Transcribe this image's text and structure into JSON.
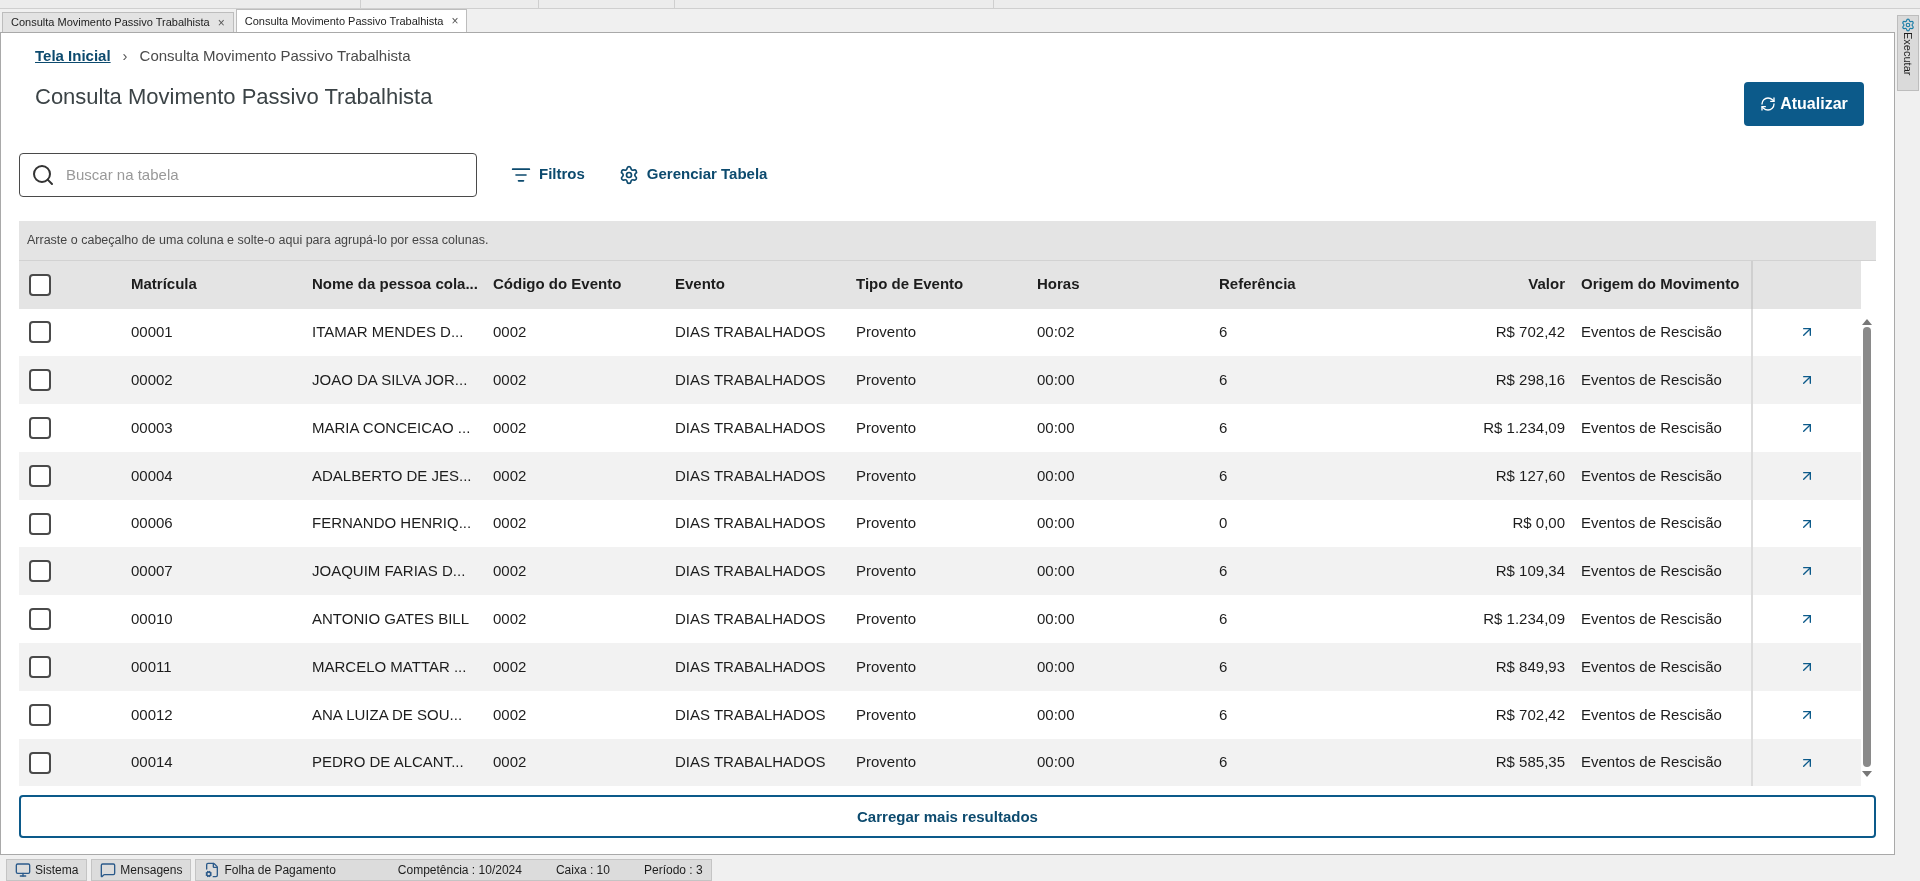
{
  "tabs": [
    {
      "label": "Consulta Movimento Passivo Trabalhista",
      "close": "×",
      "selected": false
    },
    {
      "label": "Consulta Movimento Passivo Trabalhista",
      "close": "×",
      "selected": true
    }
  ],
  "side_panel": {
    "label": "Executar"
  },
  "breadcrumb": {
    "link": "Tela Inicial",
    "separator": "›",
    "current": "Consulta Movimento Passivo Trabalhista"
  },
  "page_title": "Consulta Movimento Passivo Trabalhista",
  "refresh_button": "Atualizar",
  "search": {
    "placeholder": "Buscar na tabela"
  },
  "filters_button": "Filtros",
  "manage_table_button": "Gerenciar Tabela",
  "group_hint": "Arraste o cabeçalho de uma coluna e solte-o aqui para agrupá-lo por essa colunas.",
  "table": {
    "select_all_checked": false,
    "columns": [
      "Matrícula",
      "Nome da pessoa cola...",
      "Código do Evento",
      "Evento",
      "Tipo de Evento",
      "Horas",
      "Referência",
      "Valor",
      "Origem do Movimento"
    ],
    "rows": [
      {
        "checked": false,
        "cells": [
          "00001",
          "ITAMAR MENDES D...",
          "0002",
          "DIAS TRABALHADOS",
          "Provento",
          "00:02",
          "6",
          "R$ 702,42",
          "Eventos de Rescisão"
        ]
      },
      {
        "checked": false,
        "cells": [
          "00002",
          "JOAO DA SILVA JOR...",
          "0002",
          "DIAS TRABALHADOS",
          "Provento",
          "00:00",
          "6",
          "R$ 298,16",
          "Eventos de Rescisão"
        ]
      },
      {
        "checked": false,
        "cells": [
          "00003",
          "MARIA CONCEICAO ...",
          "0002",
          "DIAS TRABALHADOS",
          "Provento",
          "00:00",
          "6",
          "R$ 1.234,09",
          "Eventos de Rescisão"
        ]
      },
      {
        "checked": false,
        "cells": [
          "00004",
          "ADALBERTO DE JES...",
          "0002",
          "DIAS TRABALHADOS",
          "Provento",
          "00:00",
          "6",
          "R$ 127,60",
          "Eventos de Rescisão"
        ]
      },
      {
        "checked": false,
        "cells": [
          "00006",
          "FERNANDO HENRIQ...",
          "0002",
          "DIAS TRABALHADOS",
          "Provento",
          "00:00",
          "0",
          "R$ 0,00",
          "Eventos de Rescisão"
        ]
      },
      {
        "checked": false,
        "cells": [
          "00007",
          "JOAQUIM FARIAS D...",
          "0002",
          "DIAS TRABALHADOS",
          "Provento",
          "00:00",
          "6",
          "R$ 109,34",
          "Eventos de Rescisão"
        ]
      },
      {
        "checked": false,
        "cells": [
          "00010",
          "ANTONIO GATES BILL",
          "0002",
          "DIAS TRABALHADOS",
          "Provento",
          "00:00",
          "6",
          "R$ 1.234,09",
          "Eventos de Rescisão"
        ]
      },
      {
        "checked": false,
        "cells": [
          "00011",
          "MARCELO MATTAR ...",
          "0002",
          "DIAS TRABALHADOS",
          "Provento",
          "00:00",
          "6",
          "R$ 849,93",
          "Eventos de Rescisão"
        ]
      },
      {
        "checked": false,
        "cells": [
          "00012",
          "ANA LUIZA DE SOU...",
          "0002",
          "DIAS TRABALHADOS",
          "Provento",
          "00:00",
          "6",
          "R$ 702,42",
          "Eventos de Rescisão"
        ]
      },
      {
        "checked": false,
        "cells": [
          "00014",
          "PEDRO DE ALCANT...",
          "0002",
          "DIAS TRABALHADOS",
          "Provento",
          "00:00",
          "6",
          "R$ 585,35",
          "Eventos de Rescisão"
        ]
      }
    ]
  },
  "load_more_button": "Carregar mais resultados",
  "status_bar": {
    "items": [
      {
        "kind": "monitor",
        "label": "Sistema"
      },
      {
        "kind": "messages",
        "label": "Mensagens"
      },
      {
        "kind": "document",
        "label": "Folha de Pagamento",
        "info": [
          "Competência : 10/2024",
          "Caixa : 10",
          "Período : 3"
        ]
      }
    ]
  }
}
